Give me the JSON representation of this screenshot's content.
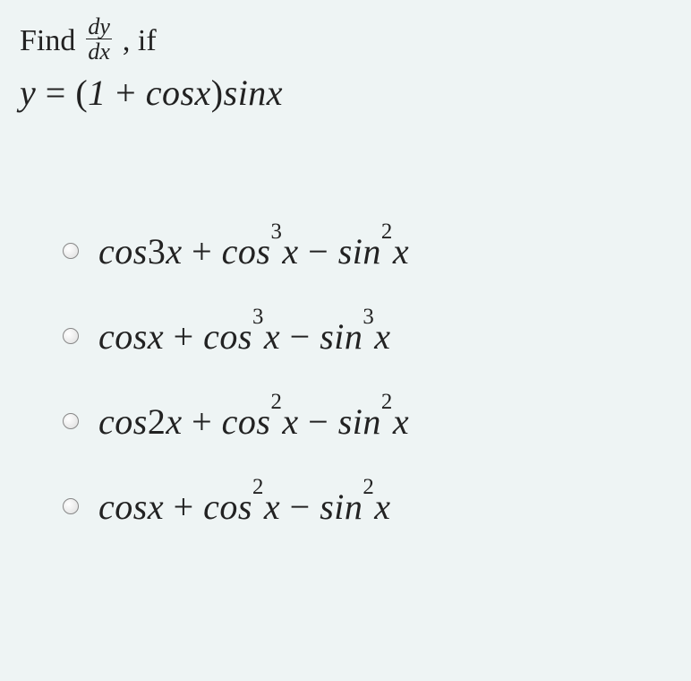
{
  "question": {
    "find_word": "Find",
    "frac_num": "dy",
    "frac_den": "dx",
    "if_word": ", if",
    "equation_html": "y <span class='op'>=</span> <span class='op'>(</span>1 <span class='op'>+</span> cosx<span class='op'>)</span>sinx"
  },
  "options": [
    {
      "html": "cos<span class='op'>3</span>x <span class='op'>+</span> cos<sup>3</sup>x <span class='op'>&minus;</span> sin<sup>2</sup>x"
    },
    {
      "html": "cosx <span class='op'>+</span> cos<sup>3</sup>x <span class='op'>&minus;</span> sin<sup>3</sup>x"
    },
    {
      "html": "cos<span class='op'>2</span>x <span class='op'>+</span> cos<sup>2</sup>x <span class='op'>&minus;</span> sin<sup>2</sup>x"
    },
    {
      "html": "cosx <span class='op'>+</span> cos<sup>2</sup>x <span class='op'>&minus;</span> sin<sup>2</sup>x"
    }
  ]
}
